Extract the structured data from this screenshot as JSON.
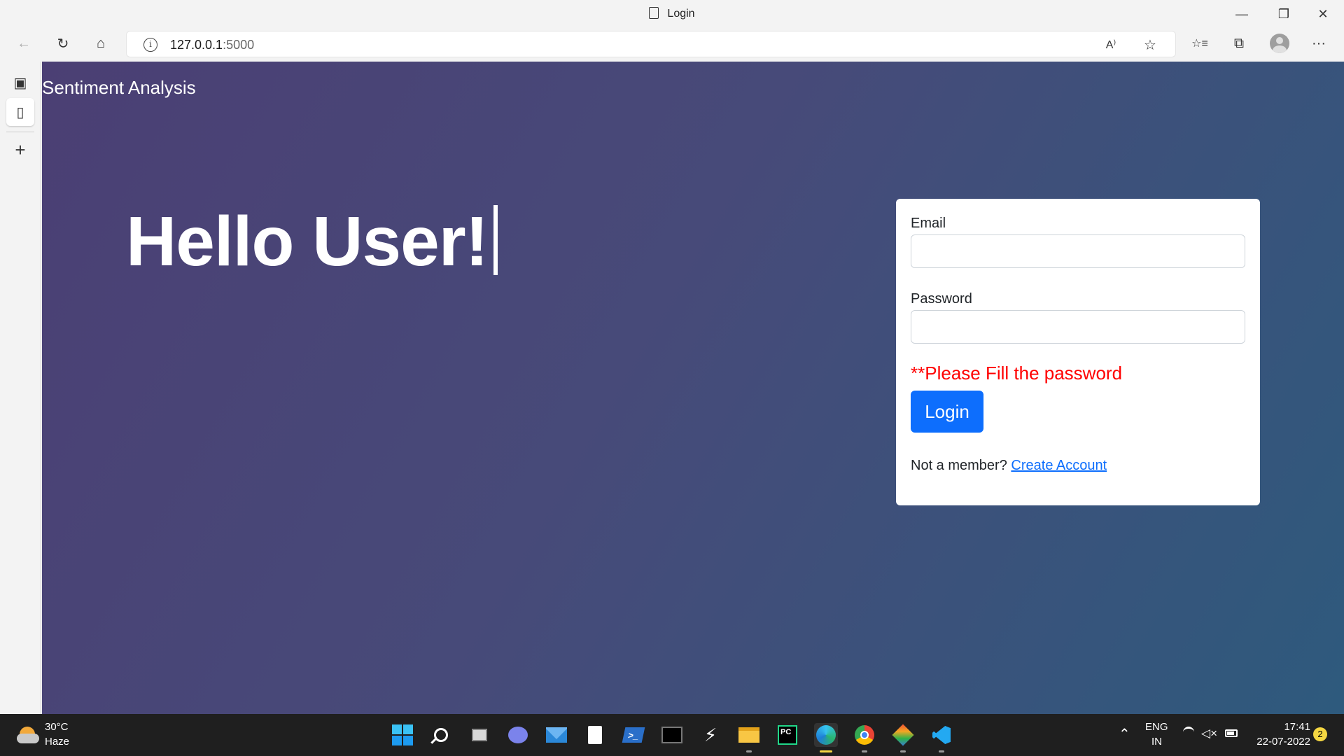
{
  "window": {
    "title": "Login",
    "minimize": "—",
    "restore": "❐",
    "close": "✕"
  },
  "toolbar": {
    "back_icon": "←",
    "refresh_icon": "↻",
    "home_icon": "⌂",
    "url_host": "127.0.0.1",
    "url_port": ":5000",
    "read_aloud_icon": "A⁾",
    "add_favorite_icon": "☆",
    "favorites_icon": "☆≡",
    "collections_icon": "⧉",
    "more_icon": "···"
  },
  "sidebar": {
    "tab_actions_icon": "▣",
    "tab_page_icon": "▯",
    "add_icon": "+"
  },
  "page": {
    "brand": "Sentiment Analysis",
    "heading": "Hello User!",
    "form": {
      "email_label": "Email",
      "email_value": "",
      "password_label": "Password",
      "password_value": "",
      "error": "**Please Fill the password",
      "login_button": "Login",
      "not_member": "Not a member?",
      "create_account": "Create Account"
    }
  },
  "taskbar": {
    "weather_temp": "30°C",
    "weather_desc": "Haze",
    "language": "ENG",
    "region": "IN",
    "time": "17:41",
    "date": "22-07-2022",
    "notifications": "2",
    "pycharm_label": "PC"
  },
  "colors": {
    "accent": "#0d6efd",
    "error": "#ff0000",
    "gradient_start": "#4b3f74",
    "gradient_end": "#2e5a7d"
  }
}
